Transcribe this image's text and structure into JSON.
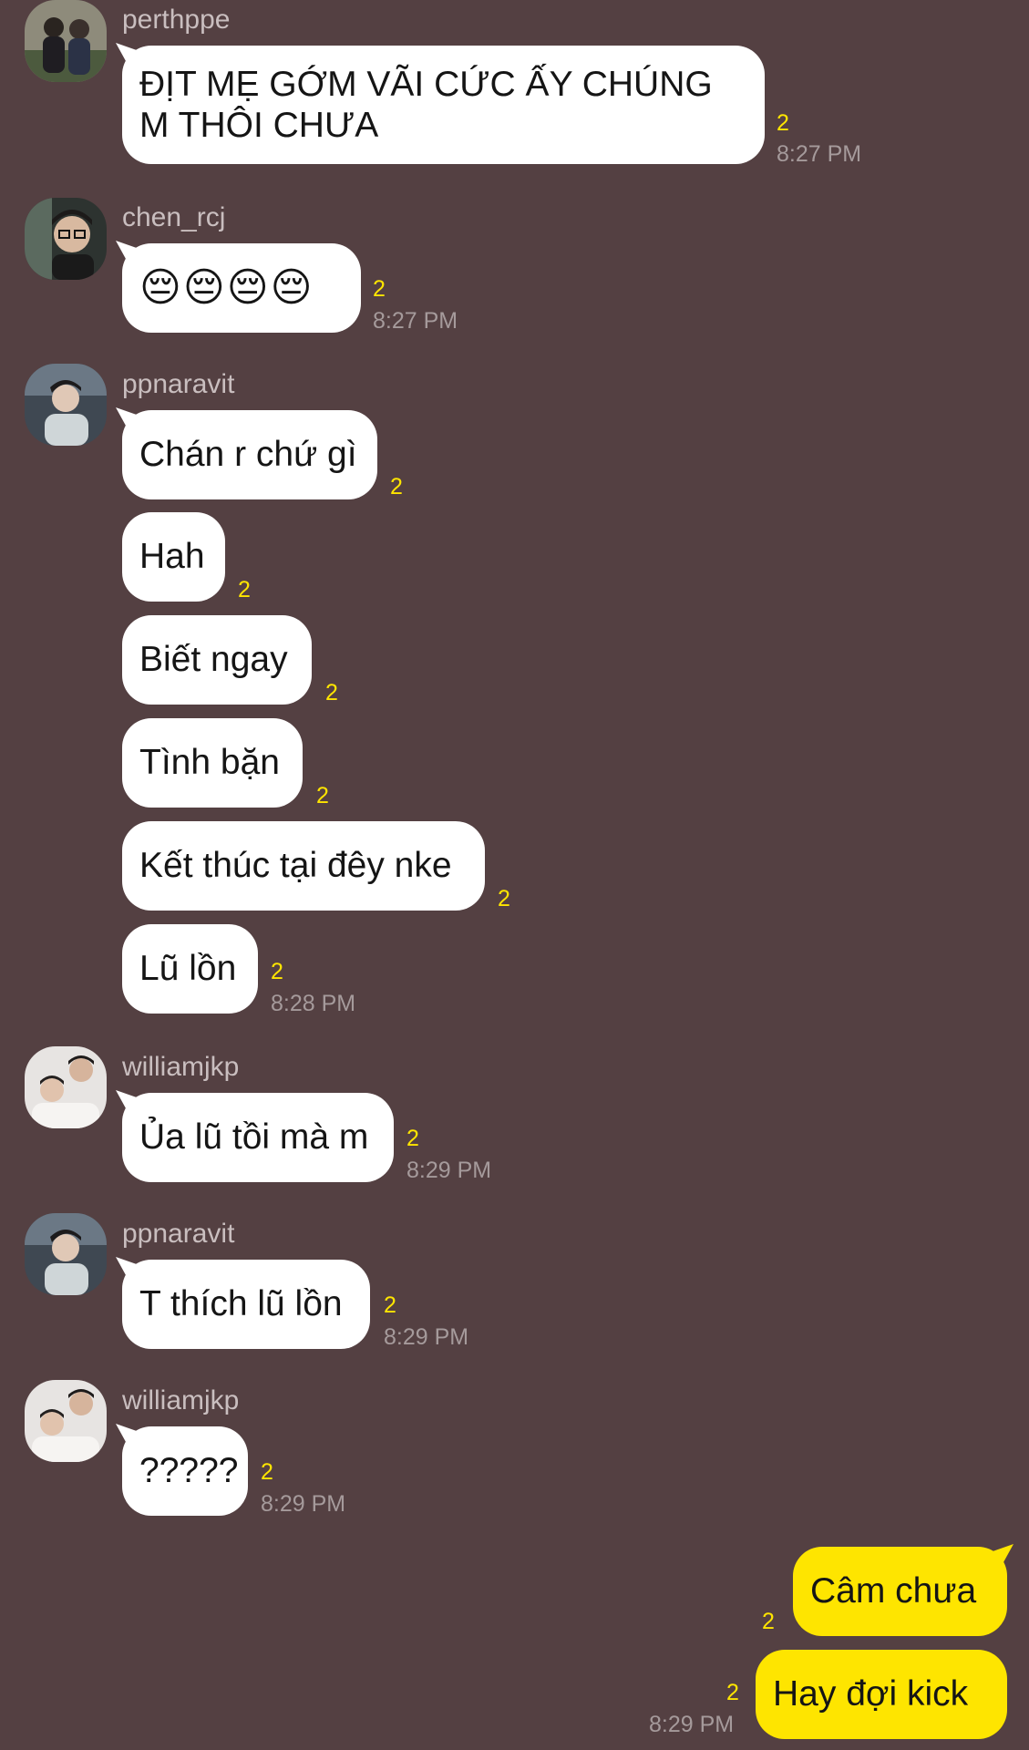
{
  "colors": {
    "background": "#544042",
    "incoming_bubble": "#ffffff",
    "outgoing_bubble": "#fee500",
    "unread_count": "#fee500",
    "sender_name": "#c9bebf",
    "timestamp": "#a59a9b"
  },
  "messages": [
    {
      "sender": "perthppe",
      "text": "ĐỊT MẸ GỚM VÃI CỨC ẤY CHÚNG M THÔI CHƯA",
      "unread": "2",
      "time": "8:27 PM"
    },
    {
      "sender": "chen_rcj",
      "text": "😔😔😔😔",
      "unread": "2",
      "time": "8:27 PM"
    },
    {
      "sender": "ppnaravit",
      "text": "Chán r chứ gì",
      "unread": "2"
    },
    {
      "text": "Hah",
      "unread": "2"
    },
    {
      "text": "Biết ngay",
      "unread": "2"
    },
    {
      "text": "Tình bặn",
      "unread": "2"
    },
    {
      "text": "Kết thúc tại đêy nke",
      "unread": "2"
    },
    {
      "text": "Lũ lồn",
      "unread": "2",
      "time": "8:28 PM"
    },
    {
      "sender": "williamjkp",
      "text": "Ủa lũ tồi mà m",
      "unread": "2",
      "time": "8:29 PM"
    },
    {
      "sender": "ppnaravit",
      "text": "T thích lũ lồn",
      "unread": "2",
      "time": "8:29 PM"
    },
    {
      "sender": "williamjkp",
      "text": "?????",
      "unread": "2",
      "time": "8:29 PM"
    },
    {
      "sender": "me",
      "text": "Câm chưa",
      "unread": "2"
    },
    {
      "sender": "me",
      "text": "Hay đợi kick",
      "unread": "2",
      "time": "8:29 PM"
    }
  ]
}
